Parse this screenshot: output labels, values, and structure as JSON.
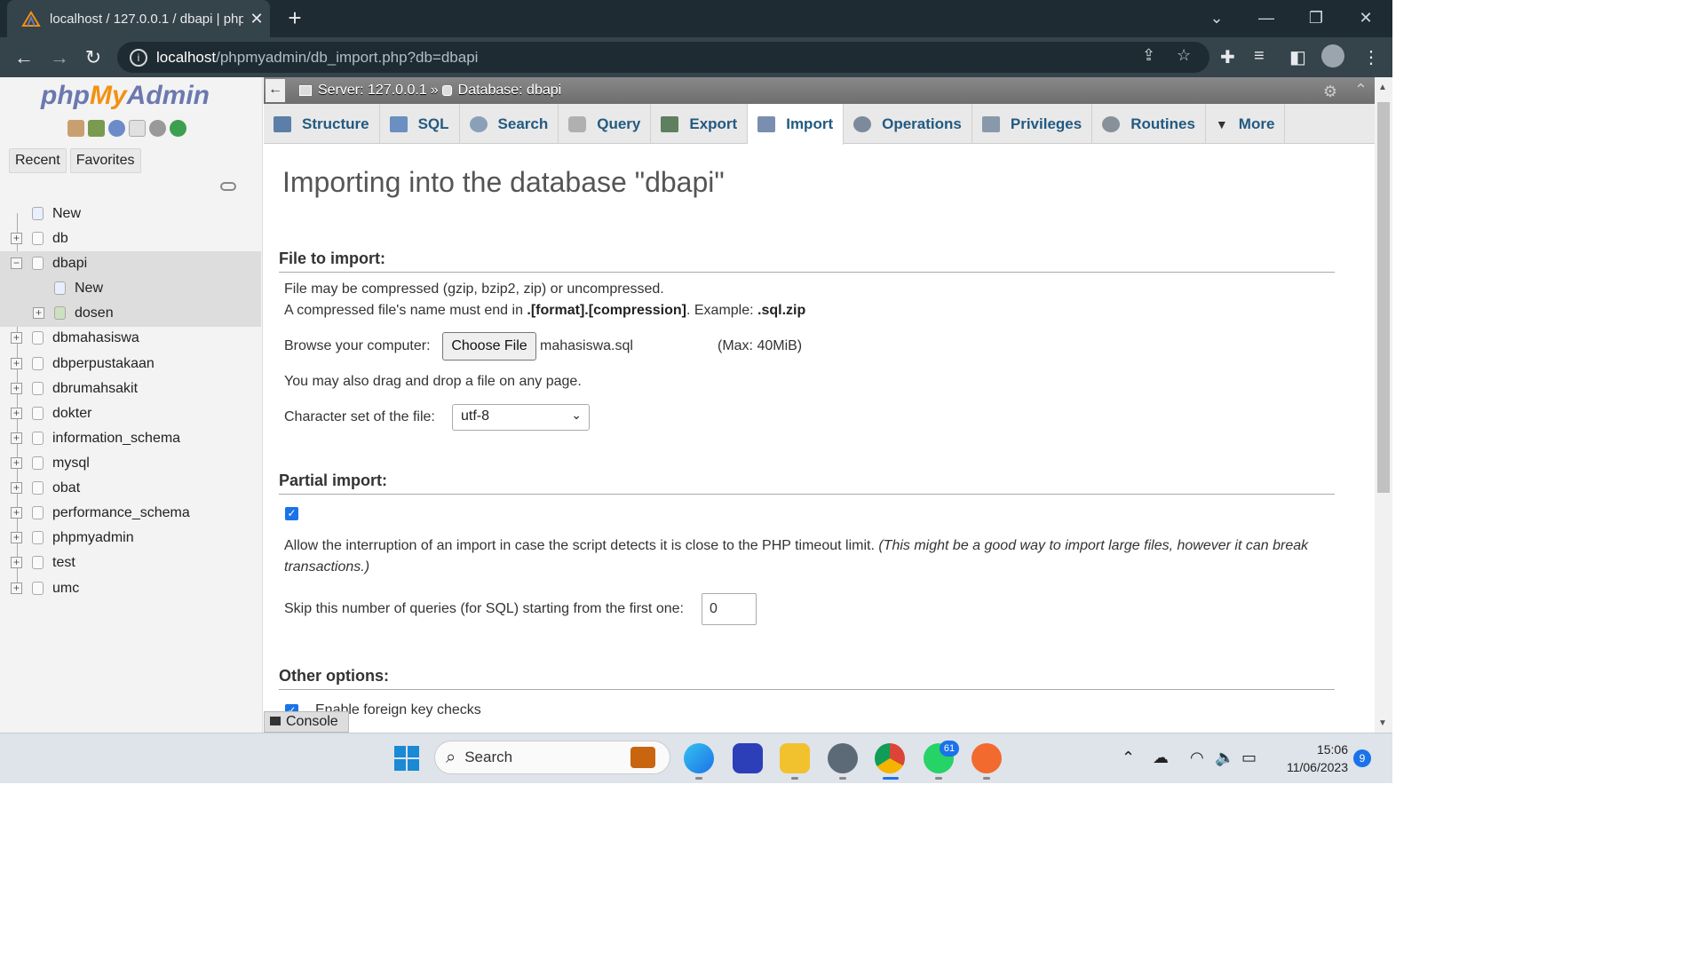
{
  "browser": {
    "tab_title": "localhost / 127.0.0.1 / dbapi | php",
    "url_host": "localhost",
    "url_path": "/phpmyadmin/db_import.php?db=dbapi"
  },
  "sidebar": {
    "logo": {
      "php": "php",
      "my": "My",
      "admin": "Admin"
    },
    "tabs": [
      "Recent",
      "Favorites"
    ],
    "tree": [
      {
        "label": "New",
        "indent": 0,
        "kind": "new"
      },
      {
        "label": "db",
        "indent": 0,
        "kind": "db"
      },
      {
        "label": "dbapi",
        "indent": 0,
        "kind": "db",
        "expanded": true
      },
      {
        "label": "New",
        "indent": 1,
        "kind": "new"
      },
      {
        "label": "dosen",
        "indent": 1,
        "kind": "table"
      },
      {
        "label": "dbmahasiswa",
        "indent": 0,
        "kind": "db"
      },
      {
        "label": "dbperpustakaan",
        "indent": 0,
        "kind": "db"
      },
      {
        "label": "dbrumahsakit",
        "indent": 0,
        "kind": "db"
      },
      {
        "label": "dokter",
        "indent": 0,
        "kind": "db"
      },
      {
        "label": "information_schema",
        "indent": 0,
        "kind": "db"
      },
      {
        "label": "mysql",
        "indent": 0,
        "kind": "db"
      },
      {
        "label": "obat",
        "indent": 0,
        "kind": "db"
      },
      {
        "label": "performance_schema",
        "indent": 0,
        "kind": "db"
      },
      {
        "label": "phpmyadmin",
        "indent": 0,
        "kind": "db"
      },
      {
        "label": "test",
        "indent": 0,
        "kind": "db"
      },
      {
        "label": "umc",
        "indent": 0,
        "kind": "db"
      }
    ]
  },
  "breadcrumb": {
    "server": "Server: 127.0.0.1",
    "separator": "»",
    "database": "Database: dbapi"
  },
  "tabs": [
    {
      "label": "Structure",
      "icon": "structure-icon",
      "color": "#5b7fa8"
    },
    {
      "label": "SQL",
      "icon": "sql-icon",
      "color": "#6a8fc0"
    },
    {
      "label": "Search",
      "icon": "search-icon",
      "color": "#8aa0b8"
    },
    {
      "label": "Query",
      "icon": "query-icon",
      "color": "#a0a0a0"
    },
    {
      "label": "Export",
      "icon": "export-icon",
      "color": "#5f7f5f"
    },
    {
      "label": "Import",
      "icon": "import-icon",
      "color": "#7a8fb0",
      "active": true
    },
    {
      "label": "Operations",
      "icon": "wrench-icon",
      "color": "#7c8a9c"
    },
    {
      "label": "Privileges",
      "icon": "privileges-icon",
      "color": "#8899aa"
    },
    {
      "label": "Routines",
      "icon": "routines-icon",
      "color": "#889099"
    },
    {
      "label": "More",
      "icon": "chevron-down-icon",
      "color": "#444"
    }
  ],
  "main": {
    "title": "Importing into the database \"dbapi\"",
    "file_section": {
      "heading": "File to import:",
      "line1": "File may be compressed (gzip, bzip2, zip) or uncompressed.",
      "line2_prefix": "A compressed file's name must end in ",
      "line2_format": ".[format].[compression]",
      "line2_mid": ". Example: ",
      "line2_example": ".sql.zip",
      "browse_label": "Browse your computer:",
      "choose_button": "Choose File",
      "chosen_file": "mahasiswa.sql",
      "max_size": "(Max: 40MiB)",
      "drag_text": "You may also drag and drop a file on any page.",
      "charset_label": "Character set of the file:",
      "charset_value": "utf-8"
    },
    "partial_section": {
      "heading": "Partial import:",
      "allow_interrupt_checked": true,
      "allow_text": "Allow the interruption of an import in case the script detects it is close to the PHP timeout limit.",
      "allow_note_1": "(This might be a good way to import large files, however it can break",
      "allow_note_2": "transactions.)",
      "skip_label": "Skip this number of queries (for SQL) starting from the first one:",
      "skip_value": "0"
    },
    "other_section": {
      "heading": "Other options:",
      "fk_label": "Enable foreign key checks",
      "fk_checked": true
    },
    "console_label": "Console"
  },
  "taskbar": {
    "search_label": "Search",
    "whatsapp_badge": "61",
    "time": "15:06",
    "date": "11/06/2023",
    "notifications": "9"
  }
}
